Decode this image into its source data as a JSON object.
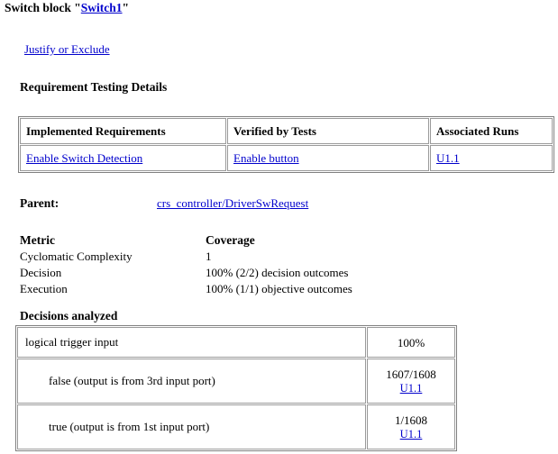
{
  "page": {
    "title_prefix": "Switch block \"",
    "title_link": "Switch1",
    "title_suffix": "\"",
    "justify_link": "Justify or Exclude",
    "section_heading": "Requirement Testing Details",
    "link_color": "#0000cc"
  },
  "requirement_table": {
    "headers": [
      "Implemented Requirements",
      "Verified by Tests",
      "Associated Runs"
    ],
    "rows": [
      {
        "implemented_requirement": "Enable Switch Detection",
        "verified_by_test": "Enable button",
        "associated_run": "U1.1"
      }
    ]
  },
  "parent": {
    "label": "Parent:",
    "value": "crs_controller/DriverSwRequest"
  },
  "metrics": {
    "header": {
      "name": "Metric",
      "coverage": "Coverage"
    },
    "rows": [
      {
        "name": "Cyclomatic Complexity",
        "coverage": "1"
      },
      {
        "name": "Decision",
        "coverage": "100% (2/2) decision outcomes"
      },
      {
        "name": "Execution",
        "coverage": "100% (1/1) objective outcomes"
      }
    ]
  },
  "decisions": {
    "heading": "Decisions analyzed",
    "rows": [
      {
        "description": "logical trigger input",
        "indent": 0,
        "value": "100%",
        "run": ""
      },
      {
        "description": "false (output is from 3rd input port)",
        "indent": 1,
        "value": "1607/1608",
        "run": "U1.1"
      },
      {
        "description": "true (output is from 1st input port)",
        "indent": 1,
        "value": "1/1608",
        "run": "U1.1"
      }
    ]
  }
}
